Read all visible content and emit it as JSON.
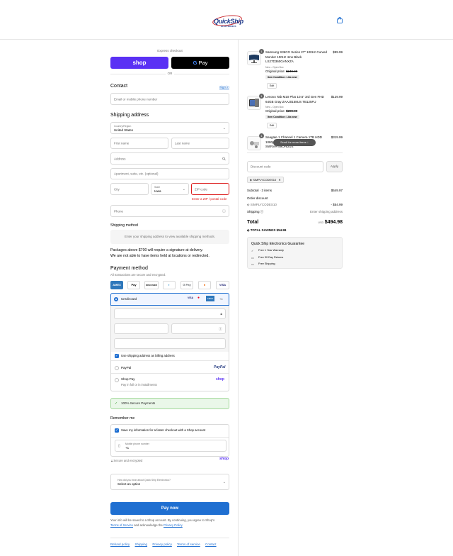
{
  "brand": {
    "name_part1": "Quick",
    "name_part2": "Ship",
    "tagline": "ELECTRONICS"
  },
  "colors": {
    "accent": "#1f6fd1",
    "error": "#dd1d1d",
    "shop_purple": "#5a31f4",
    "success_bg": "#eaf7e9"
  },
  "express": {
    "label": "Express checkout",
    "shop_label": "shop",
    "gpay_g": "G",
    "gpay_label": "Pay",
    "or": "OR"
  },
  "contact": {
    "heading": "Contact",
    "sign_in": "Sign in",
    "email_placeholder": "Email or mobile phone number"
  },
  "shipping": {
    "heading": "Shipping address",
    "country_label": "Country/Region",
    "country_value": "United States",
    "first_name": "First name",
    "last_name": "Last name",
    "address": "Address",
    "apartment": "Apartment, suite, etc. (optional)",
    "city": "City",
    "state_label": "State",
    "state_value": "Iowa",
    "zip": "ZIP code",
    "zip_error": "Enter a ZIP / postal code",
    "phone": "Phone"
  },
  "shipping_method": {
    "heading": "Shipping method",
    "notice": "Enter your shipping address to view available shipping methods.",
    "para_line1": "Packages above $700 will require a signature at delivery.",
    "para_line2": "We are not able to have items held at locations or redirected."
  },
  "payment": {
    "heading": "Payment method",
    "sub": "All transactions are secure and encrypted.",
    "icons": [
      "AMEX",
      "Apple Pay",
      "DISCOVER",
      "Diners",
      "G Pay",
      "Mastercard",
      "VISA"
    ],
    "credit_card": "Credit card",
    "card_brands": [
      "VISA",
      "MC",
      "AMEX"
    ],
    "more_cards": "+4",
    "billing_same": "Use shipping address as billing address",
    "paypal": "PayPal",
    "paypal_logo": "PayPal",
    "shoppay": "Shop Pay",
    "shoppay_sub": "Pay in full or in installments",
    "shoppay_logo": "shop",
    "secure": "100% Secure Payments"
  },
  "remember": {
    "heading": "Remember me",
    "save_label": "Save my information for a faster checkout with a Shop account",
    "mobile_label": "Mobile phone number",
    "mobile_prefix": "+1",
    "secure_note": "Secure and encrypted",
    "shop_logo": "shop"
  },
  "survey": {
    "label": "How did you hear about Quick Ship Electronics?",
    "value": "Select an option"
  },
  "pay_now": "Pay now",
  "legal": {
    "line1": "Your info will be saved to a Shop account. By continuing, you agree to Shop's",
    "terms": "Terms of Service",
    "mid": "and acknowledge the",
    "privacy": "Privacy Policy"
  },
  "footer": [
    "Refund policy",
    "Shipping",
    "Privacy policy",
    "Terms of service",
    "Contact"
  ],
  "cart": {
    "items": [
      {
        "qty": "1",
        "title_lines": [
          "Samsung S36CG Series 27\" 100Hz Curved",
          "Monitor 100Hz 4ms Black",
          "LS27D360GANXZA"
        ],
        "variant": "New - Open Box",
        "original_label": "Original price:",
        "original_price": "$249.99",
        "condition": "Item Condition: Like-new",
        "edit": "Edit",
        "price": "$99.99"
      },
      {
        "qty": "1",
        "title_lines": [
          "Lenovo Tab M10 Plus 10.6\" 3rd Gen FHD",
          "64GB Gray ZAAJ0158US TB125FU"
        ],
        "variant": "New - Open Box",
        "original_label": "Original price:",
        "original_price": "$289.99",
        "condition": "Item Condition: Like-new",
        "edit": "Edit",
        "price": "$129.99"
      },
      {
        "qty": "1",
        "title_lines": [
          "Seagate 1 Channel 1 Camera 1TB HDD",
          "1080p",
          "SWNVR-89OHDUS"
        ],
        "price": "$319.99"
      }
    ],
    "scroll_hint": "Scroll for more items",
    "discount_placeholder": "Discount code",
    "apply": "Apply",
    "chip": "SIMPLYCODES10",
    "subtotal_label": "Subtotal · 3 items",
    "subtotal": "$549.97",
    "order_discount": "Order discount",
    "discount_code": "SIMPLYCODES10",
    "discount_value": "- $54.99",
    "shipping_label": "Shipping",
    "shipping_value": "Enter shipping address",
    "total_label": "Total",
    "currency": "USD",
    "total": "$494.98",
    "savings_label": "TOTAL SAVINGS",
    "savings": "$54.99"
  },
  "guarantee": {
    "heading": "Quick Ship Electronics Guarantee",
    "items": [
      "Free 1 Year Warranty",
      "Free 30 Day Returns",
      "Free Shipping"
    ]
  }
}
